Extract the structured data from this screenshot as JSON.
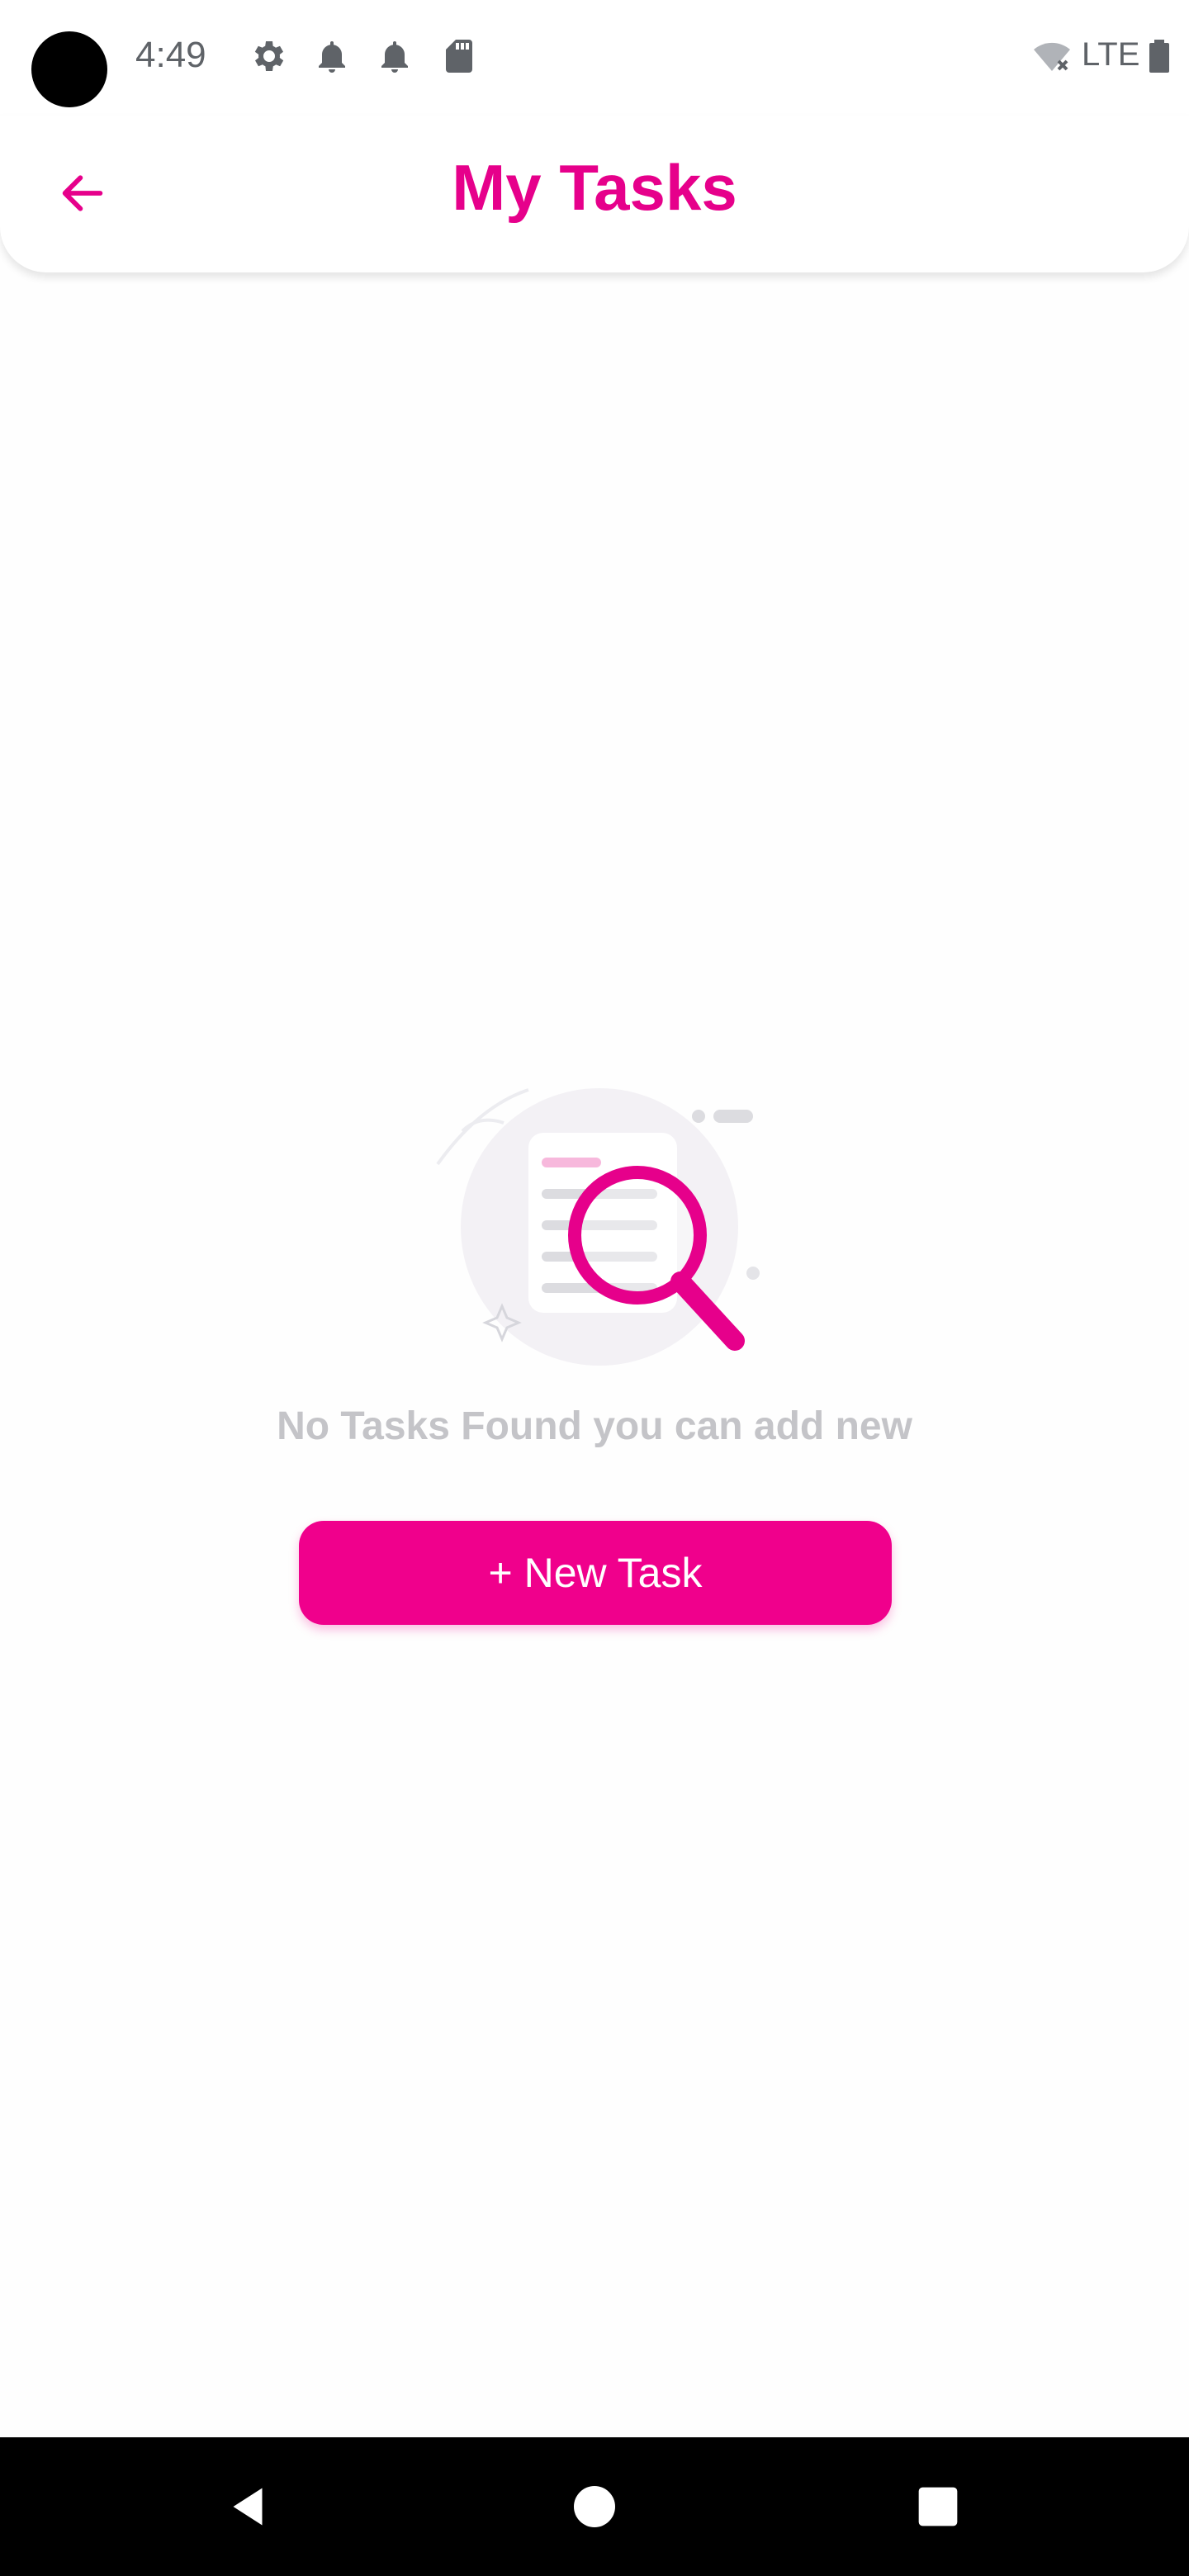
{
  "status_bar": {
    "time": "4:49",
    "network": "LTE",
    "icons": [
      "gear-icon",
      "notification-bell-icon",
      "notification-bell-icon",
      "sd-card-icon",
      "wifi-off-icon",
      "battery-icon"
    ]
  },
  "header": {
    "title": "My Tasks",
    "back_icon": "arrow-left-icon"
  },
  "empty_state": {
    "illustration": "document-search-illustration",
    "message": "No Tasks Found you can add new",
    "button_label": "+ New Task"
  },
  "nav_bar": {
    "icons": [
      "back-triangle-icon",
      "home-circle-icon",
      "recents-square-icon"
    ]
  },
  "colors": {
    "accent": "#e6008b",
    "button": "#f0008c",
    "muted_text": "#c4c4c8"
  }
}
